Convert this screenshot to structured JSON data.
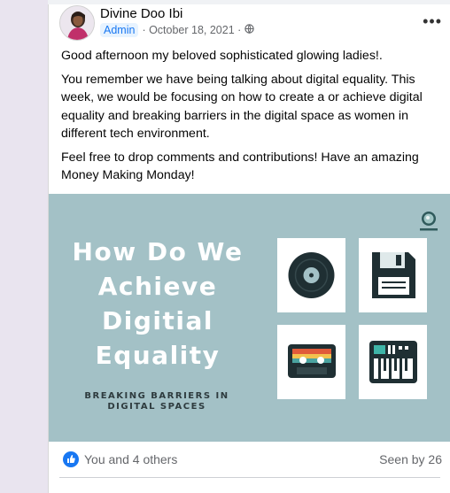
{
  "post": {
    "author": "Divine Doo Ibi",
    "role_badge": "Admin",
    "date": "· October 18, 2021 ·",
    "more_label": "•••",
    "paragraphs": [
      "Good afternoon my beloved sophisticated glowing ladies!.",
      "You remember we have being talking about digital equality. This week, we would be focusing on how to create a or achieve digital equality and breaking barriers in the digital space as women in different tech environment.",
      "Feel free to drop comments and contributions! Have an amazing Money Making Monday!"
    ]
  },
  "banner": {
    "headline_lines": [
      "How Do We",
      "Achieve",
      "Digitial",
      "Equality"
    ],
    "subtitle_lines": [
      "BREAKING BARRIERS IN",
      "DIGITAL SPACES"
    ],
    "background": "#a3c1c6",
    "icons": [
      "vinyl-record-icon",
      "floppy-disk-icon",
      "cassette-tape-icon",
      "synthesizer-icon"
    ]
  },
  "reactions": {
    "summary": "You and 4 others",
    "seen": "Seen by 26",
    "accent": "#1877f2"
  }
}
